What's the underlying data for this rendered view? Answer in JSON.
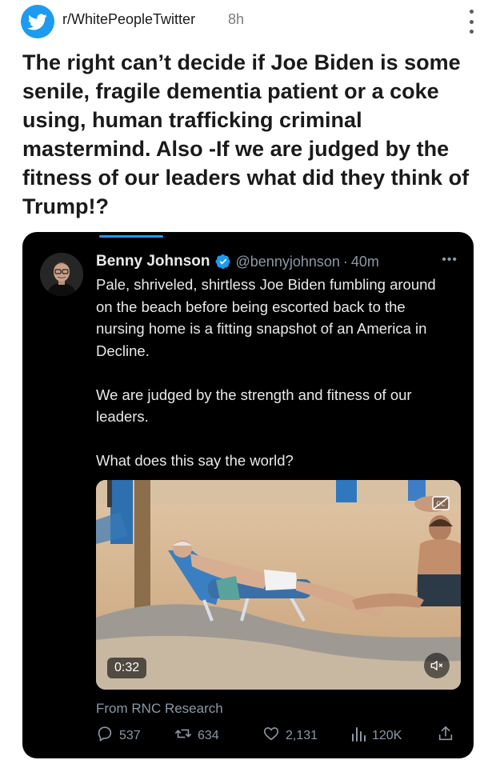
{
  "subreddit": {
    "name": "r/WhitePeopleTwitter",
    "time": "8h"
  },
  "post": {
    "title": "The right can’t decide if Joe Biden is some senile, fragile dementia patient or a coke using, human trafficking criminal mastermind. Also -If we are judged by the fitness of our leaders what did they think of Trump!?"
  },
  "tweet": {
    "name": "Benny Johnson",
    "handle": "@bennyjohnson",
    "separator": "·",
    "time": "40m",
    "paragraphs": [
      "Pale, shriveled, shirtless Joe Biden fumbling around on the beach before being escorted back to the nursing home is a fitting snapshot of an America in Decline.",
      "We are judged by the strength and fitness of our leaders.",
      "What does this say the world?"
    ],
    "video_duration": "0:32",
    "from_label": "From RNC Research",
    "replies": "537",
    "reposts": "634",
    "likes": "2,131",
    "views": "120K"
  },
  "colors": {
    "accent": "#1d9bf0",
    "tweet_bg": "#000000",
    "tweet_text": "#e7e9ea",
    "tweet_muted": "#8b98a5"
  },
  "icons": [
    "subreddit-avatar-icon",
    "more-options-icon",
    "verified-badge-icon",
    "tweet-more-icon",
    "captions-icon",
    "mute-icon",
    "reply-icon",
    "repost-icon",
    "like-icon",
    "views-icon",
    "share-icon"
  ]
}
